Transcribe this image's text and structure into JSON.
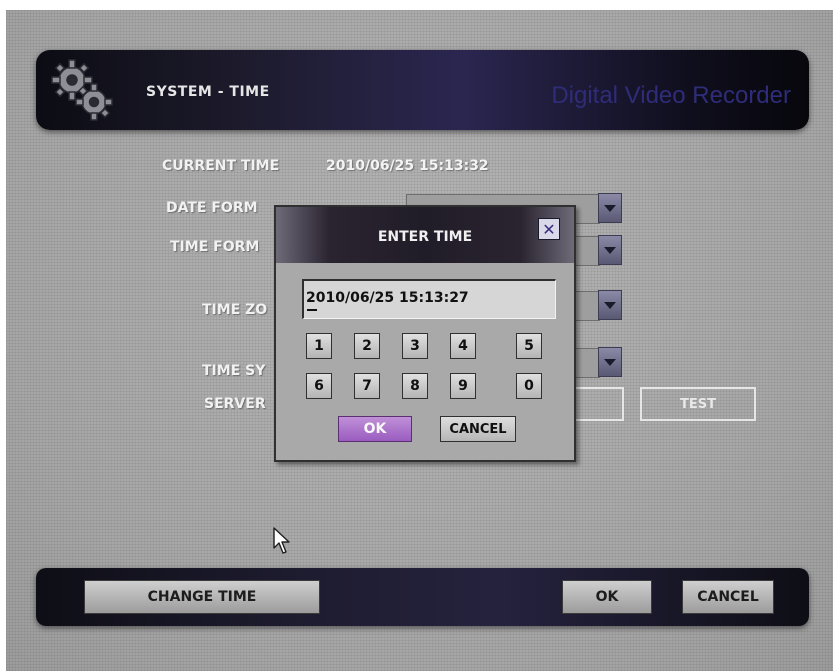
{
  "header": {
    "title": "SYSTEM - TIME",
    "brand": "Digital Video Recorder",
    "icon": "gears-icon"
  },
  "settings": {
    "current_time_label": "CURRENT TIME",
    "current_time_value": "2010/06/25 15:13:32",
    "date_format_label": "DATE FORM",
    "time_format_label": "TIME FORM",
    "time_zone_label": "TIME ZO",
    "time_sync_label": "TIME SY",
    "server_label": "SERVER",
    "test_label": "TEST"
  },
  "dialog": {
    "title": "ENTER TIME",
    "close_icon": "close-icon",
    "input_value": "2010/06/25 15:13:27",
    "keys": [
      "1",
      "2",
      "3",
      "4",
      "5",
      "6",
      "7",
      "8",
      "9",
      "0"
    ],
    "ok_label": "OK",
    "cancel_label": "CANCEL"
  },
  "footer": {
    "change_time_label": "CHANGE TIME",
    "ok_label": "OK",
    "cancel_label": "CANCEL"
  },
  "colors": {
    "screen_bg": "#ababab",
    "header_bg": "#1c1a2a",
    "brand_text": "#2f2c7a",
    "ok_highlight": "#9a5cc0"
  }
}
